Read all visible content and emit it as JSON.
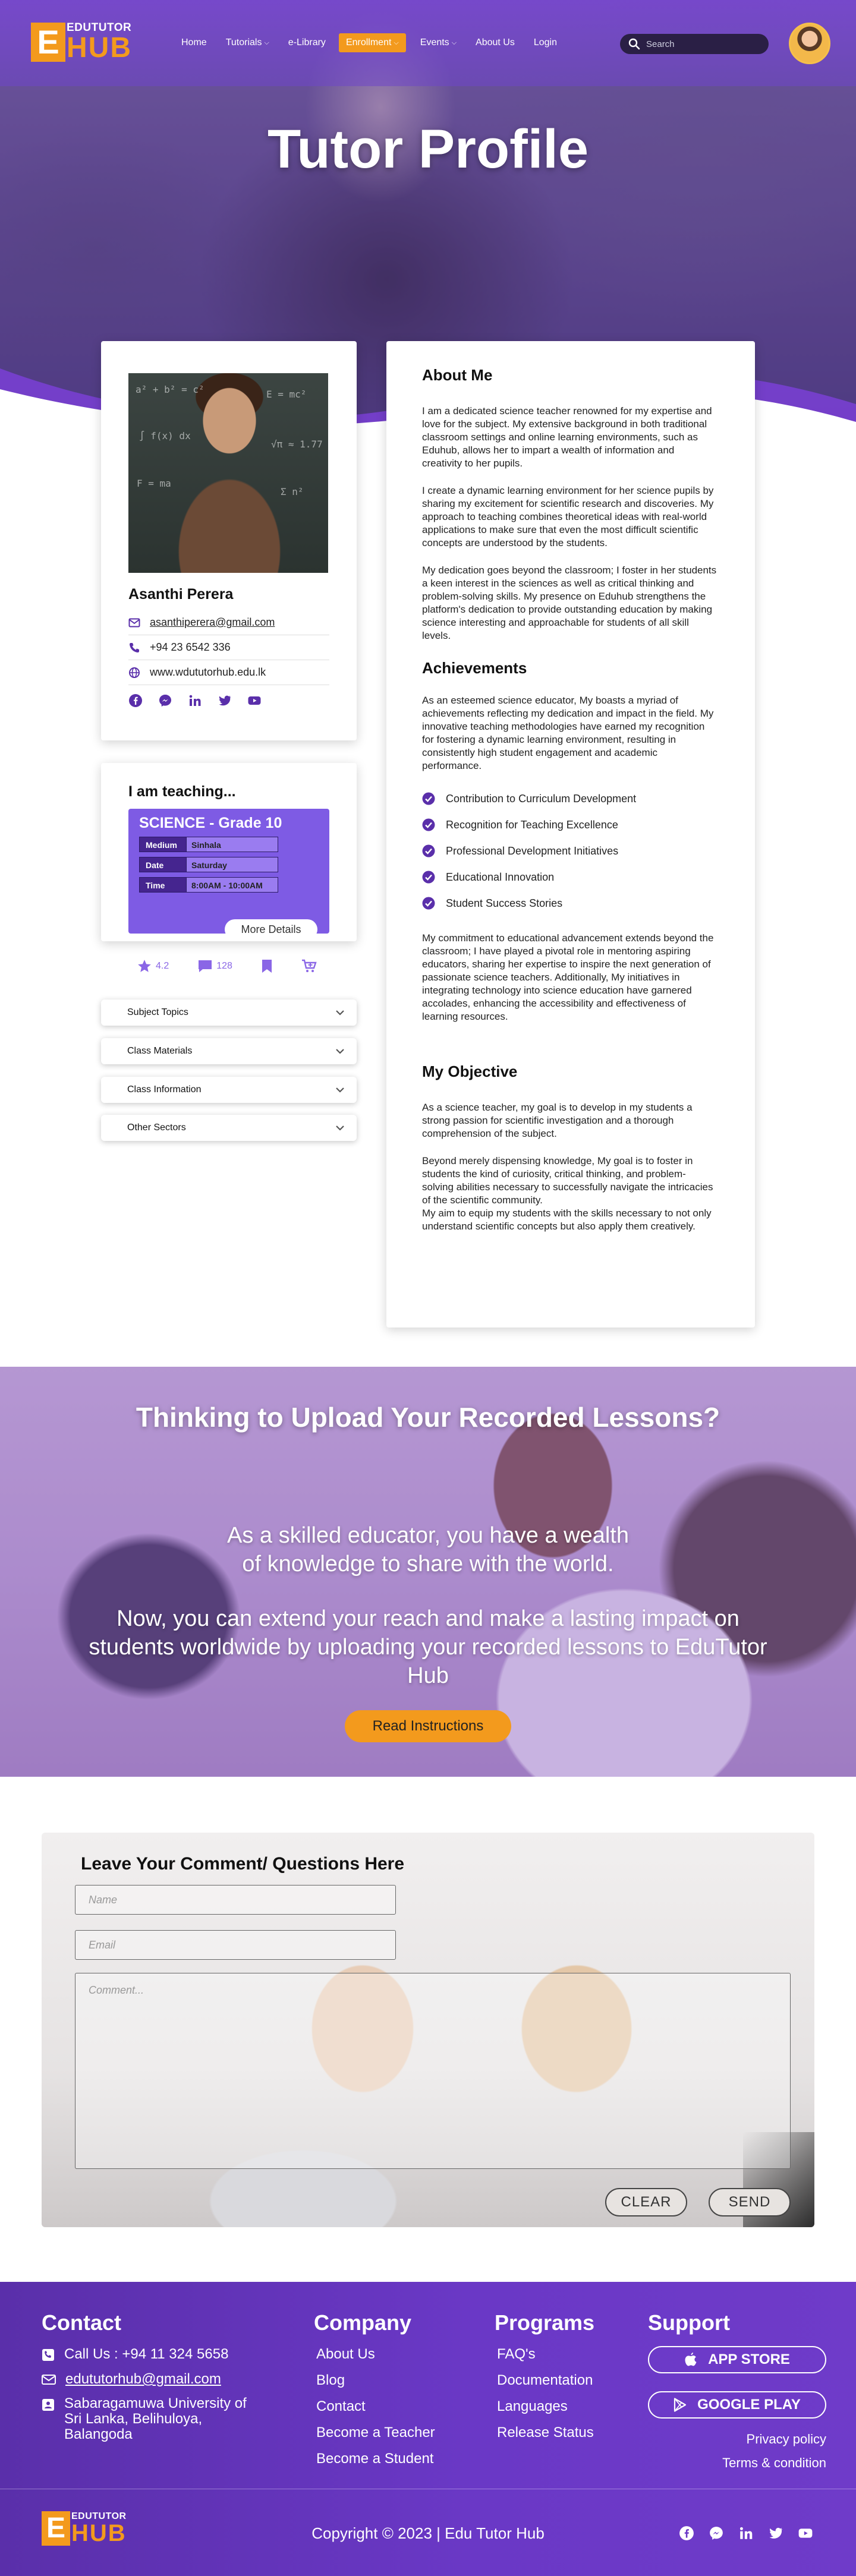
{
  "nav": {
    "logo_top": "EDUTUTOR",
    "logo_bottom": "HUB",
    "logo_letter": "E",
    "items": [
      {
        "label": "Home"
      },
      {
        "label": "Tutorials"
      },
      {
        "label": "e-Library"
      },
      {
        "label": "Enrollment"
      },
      {
        "label": "Events"
      },
      {
        "label": "About Us"
      },
      {
        "label": "Login"
      }
    ],
    "search_placeholder": "Search"
  },
  "hero": {
    "title": "Tutor Profile"
  },
  "tutor": {
    "name": "Asanthi Perera",
    "email": "asanthiperera@gmail.com",
    "phone": "+94 23 6542 336",
    "website": "www.wdututorhub.edu.lk",
    "chalk": [
      "a² + b² = c²",
      "E = mc²",
      "∫ f(x) dx",
      "√π ≈ 1.77",
      "F = ma",
      "Σ n²"
    ]
  },
  "teaching": {
    "title": "I am teaching...",
    "class_name": "SCIENCE - Grade 10",
    "rows": [
      {
        "label": "Medium",
        "value": "Sinhala"
      },
      {
        "label": "Date",
        "value": "Saturday"
      },
      {
        "label": "Time",
        "value": "8:00AM - 10:00AM"
      }
    ],
    "more_label": "More Details",
    "rating": "4.2",
    "comments": "128"
  },
  "accordions": [
    {
      "label": "Subject Topics"
    },
    {
      "label": "Class Materials"
    },
    {
      "label": "Class Information"
    },
    {
      "label": "Other Sectors"
    }
  ],
  "about": {
    "heading": "About Me",
    "paragraphs": [
      "I am a dedicated science teacher renowned for my expertise and love for the subject. My  extensive background in both traditional classroom settings and online learning environments, such as Eduhub, allows her to impart a wealth of information and creativity to her pupils.",
      " I create a dynamic learning environment for her science pupils by sharing my excitement for scientific research and discoveries. My approach to teaching combines theoretical ideas with real-world applications to make sure that even the most difficult scientific concepts are understood by the students.",
      "My dedication goes beyond the classroom; I foster in her students a keen interest in the sciences as well as critical thinking and problem-solving skills. My presence on Eduhub strengthens the platform's dedication to provide outstanding education by making science interesting and approachable for students of all skill levels."
    ]
  },
  "achievements": {
    "heading": "Achievements",
    "intro": "As an esteemed science educator, My boasts a myriad of achievements reflecting my dedication and impact in the field. My innovative teaching methodologies have earned my recognition for fostering a dynamic learning environment, resulting in consistently high student engagement and academic performance.",
    "items": [
      "Contribution to Curriculum Development",
      "Recognition for Teaching Excellence",
      "Professional Development Initiatives",
      "Educational Innovation",
      "Student Success Stories"
    ],
    "outro": "My commitment to educational advancement extends beyond the classroom; I have played a pivotal role in mentoring aspiring educators, sharing her expertise to inspire the next generation of passionate science teachers. Additionally, My initiatives in integrating technology into science education have garnered accolades, enhancing the accessibility and effectiveness of learning resources."
  },
  "objective": {
    "heading": "My Objective",
    "paragraphs": [
      "As a science teacher, my goal is to develop in my students a strong passion for scientific investigation and a thorough comprehension of the subject.",
      "Beyond merely dispensing knowledge, My goal is to foster in students the kind of curiosity, critical thinking, and problem-solving abilities necessary to successfully navigate the intricacies of the scientific community.",
      "My aim to equip  my students with the skills necessary to not only understand scientific concepts but also apply them creatively."
    ]
  },
  "upload": {
    "title": "Thinking to Upload Your Recorded Lessons?",
    "p1": "As a skilled educator, you have a wealth of knowledge  to share with the world.",
    "p2": "Now, you can extend your reach and make a lasting impact on students worldwide by uploading your recorded lessons to EduTutor Hub",
    "button": "Read Instructions"
  },
  "comment": {
    "title": "Leave Your Comment/ Questions Here",
    "name_placeholder": "Name",
    "email_placeholder": "Email",
    "comment_placeholder": "Comment...",
    "clear": "CLEAR",
    "send": "SEND"
  },
  "footer": {
    "contact_heading": "Contact",
    "phone": "Call Us : +94 11 324 5658",
    "email": "edututorhub@gmail.com",
    "address": "Sabaragamuwa University of Sri Lanka, Belihuloya, Balangoda",
    "company_heading": "Company",
    "company_links": [
      "About Us",
      "Blog",
      "Contact",
      "Become a Teacher",
      "Become a Student"
    ],
    "programs_heading": "Programs",
    "programs_links": [
      "FAQ's",
      "Documentation",
      "Languages",
      "Release Status"
    ],
    "support_heading": "Support",
    "app_store": "APP STORE",
    "google_play": "GOOGLE PLAY",
    "privacy": "Privacy policy",
    "terms": "Terms & condition",
    "copyright": "Copyright © 2023 | Edu Tutor Hub"
  },
  "colors": {
    "brand_purple": "#6a38c6",
    "accent_orange": "#f39a1d",
    "class_purple": "#7e5be4"
  },
  "icons": [
    "search-icon",
    "email-icon",
    "phone-icon",
    "globe-icon",
    "facebook-icon",
    "messenger-icon",
    "linkedin-icon",
    "twitter-icon",
    "youtube-icon",
    "star-icon",
    "comment-icon",
    "bookmark-icon",
    "cart-icon",
    "check-circle-icon",
    "chevron-down-icon",
    "apple-icon",
    "play-icon"
  ]
}
